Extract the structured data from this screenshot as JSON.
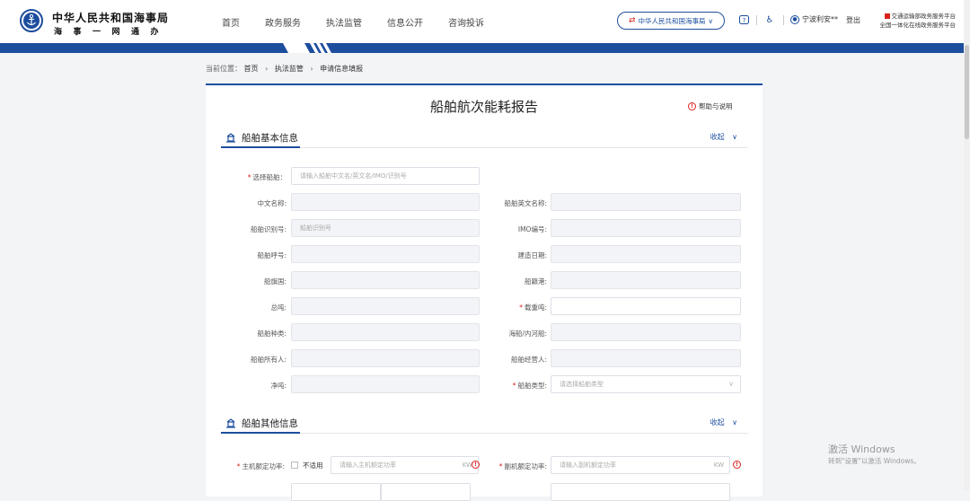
{
  "header": {
    "org_name": "中华人民共和国海事局",
    "org_subtitle": "海事一网通办",
    "nav": [
      "首页",
      "政务服务",
      "执法监管",
      "信息公开",
      "咨询投诉"
    ],
    "org_selector": "中华人民共和国海事局",
    "user_name": "宁波利安**",
    "logout": "登出",
    "platform_line1": "交通运输部政务服务平台",
    "platform_line2": "全国一体化在线政务服务平台"
  },
  "breadcrumb": {
    "prefix": "当前位置：",
    "items": [
      "首页",
      "执法监管",
      "申请信息填报"
    ],
    "separator": "›"
  },
  "page": {
    "title": "船舶航次能耗报告",
    "help": "帮助与说明"
  },
  "section_basic": {
    "title": "船舶基本信息",
    "collapse": "收起",
    "select_ship_label": "选择船舶：",
    "select_ship_placeholder": "请输入船舶中文名/英文名/IMO/识别号",
    "fields": [
      {
        "label": "中文名称:",
        "value": ""
      },
      {
        "label": "船舶英文名称:",
        "value": ""
      },
      {
        "label": "船舶识别号:",
        "value": "船舶识别号"
      },
      {
        "label": "IMO编号:",
        "value": ""
      },
      {
        "label": "船舶呼号:",
        "value": ""
      },
      {
        "label": "建造日期:",
        "value": ""
      },
      {
        "label": "船旗国:",
        "value": ""
      },
      {
        "label": "船籍港:",
        "value": ""
      },
      {
        "label": "总吨:",
        "value": ""
      },
      {
        "label": "载重吨:",
        "value": ""
      },
      {
        "label": "船舶种类:",
        "value": ""
      },
      {
        "label": "海船/内河船:",
        "value": ""
      },
      {
        "label": "船舶所有人:",
        "value": ""
      },
      {
        "label": "船舶经营人:",
        "value": ""
      },
      {
        "label": "净吨:",
        "value": ""
      },
      {
        "label": "船舶类型:",
        "value": "请选择船舶类型"
      }
    ]
  },
  "section_other": {
    "title": "船舶其他信息",
    "collapse": "收起",
    "main_engine_label": "主机额定功率:",
    "not_applicable": "不适用",
    "main_engine_placeholder": "请输入主机额定功率",
    "aux_engine_label": "副机额定功率:",
    "aux_engine_placeholder": "请输入副机额定功率",
    "unit": "KW"
  },
  "watermark": {
    "line1": "激活 Windows",
    "line2": "转到\"设置\"以激活 Windows。"
  },
  "colors": {
    "primary": "#1d4e9e",
    "required": "#d9221c"
  }
}
